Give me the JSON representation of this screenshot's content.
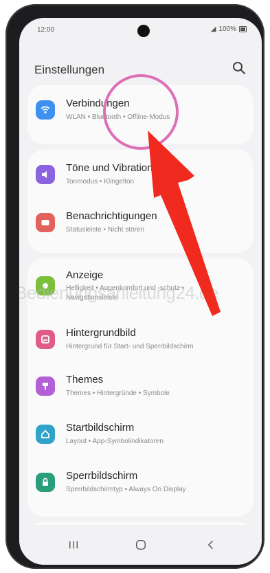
{
  "status_bar": {
    "time": "12:00",
    "battery": "100%"
  },
  "header": {
    "title": "Einstellungen"
  },
  "items": [
    {
      "label": "Verbindungen",
      "sub": "WLAN • Bluetooth • Offline-Modus",
      "color": "#3d8ff0",
      "icon": "wifi-icon"
    },
    {
      "label": "Töne und Vibration",
      "sub": "Tonmodus • Klingelton",
      "color": "#8b62e0",
      "icon": "speaker-icon"
    },
    {
      "label": "Benachrichtigungen",
      "sub": "Statusleiste • Nicht stören",
      "color": "#e4625e",
      "icon": "notification-icon"
    },
    {
      "label": "Anzeige",
      "sub": "Helligkeit • Augenkomfort und -schutz •",
      "sub2": "Navigationsleiste",
      "color": "#7cbf3a",
      "icon": "display-icon"
    },
    {
      "label": "Hintergrundbild",
      "sub": "Hintergrund für Start- und Sperrbildschirm",
      "color": "#e05b86",
      "icon": "wallpaper-icon"
    },
    {
      "label": "Themes",
      "sub": "Themes • Hintergründe • Symbole",
      "color": "#b35fd6",
      "icon": "themes-icon"
    },
    {
      "label": "Startbildschirm",
      "sub": "Layout • App-Symbolindikatoren",
      "color": "#2fa3c9",
      "icon": "home-icon"
    },
    {
      "label": "Sperrbildschirm",
      "sub": "Sperrbildschirmtyp • Always On Display",
      "color": "#2a9d7a",
      "icon": "lock-icon"
    }
  ],
  "watermark": "Bedienungsanleitung24.de",
  "annotation_colors": {
    "circle": "#dd6fb6",
    "arrow": "#f02a1e"
  }
}
